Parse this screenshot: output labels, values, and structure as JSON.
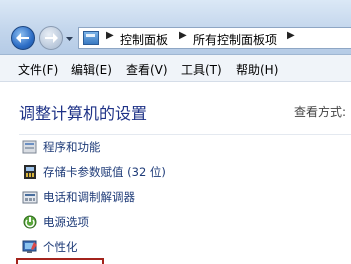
{
  "address_bar": {
    "crumbs": [
      "控制面板",
      "所有控制面板项"
    ]
  },
  "menu": {
    "items": [
      "文件(F)",
      "编辑(E)",
      "查看(V)",
      "工具(T)",
      "帮助(H)"
    ]
  },
  "main": {
    "title": "调整计算机的设置",
    "view_by_label": "查看方式:",
    "items": [
      {
        "label": "程序和功能",
        "icon": "programs-features-icon"
      },
      {
        "label": "存储卡参数赋值 (32 位)",
        "icon": "memory-card-icon"
      },
      {
        "label": "电话和调制解调器",
        "icon": "phone-modem-icon"
      },
      {
        "label": "电源选项",
        "icon": "power-options-icon"
      },
      {
        "label": "个性化",
        "icon": "personalization-icon"
      }
    ]
  },
  "colors": {
    "title_blue": "#1e3287",
    "link_blue": "#1e3b78",
    "highlight_red": "#a3231c"
  }
}
